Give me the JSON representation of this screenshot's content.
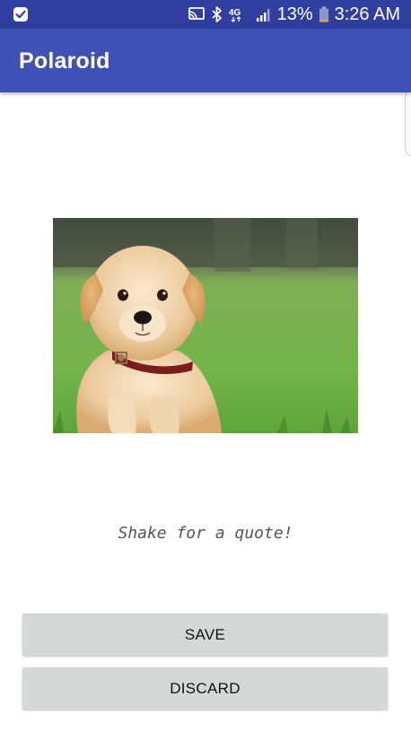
{
  "status_bar": {
    "network": "4G",
    "battery_percent": "13%",
    "time": "3:26 AM",
    "icons": [
      "check-notification-icon",
      "cast-icon",
      "bluetooth-icon",
      "4g-lte-icon",
      "signal-icon",
      "battery-icon"
    ]
  },
  "app_bar": {
    "title": "Polaroid"
  },
  "photo": {
    "subject": "puppy-photo"
  },
  "quote_text": "Shake for a quote!",
  "buttons": {
    "save_label": "SAVE",
    "discard_label": "DISCARD"
  },
  "colors": {
    "status_bar": "#303F9F",
    "app_bar": "#3F51B5",
    "button_bg": "#D6D7D7",
    "quote_text": "#555555"
  }
}
